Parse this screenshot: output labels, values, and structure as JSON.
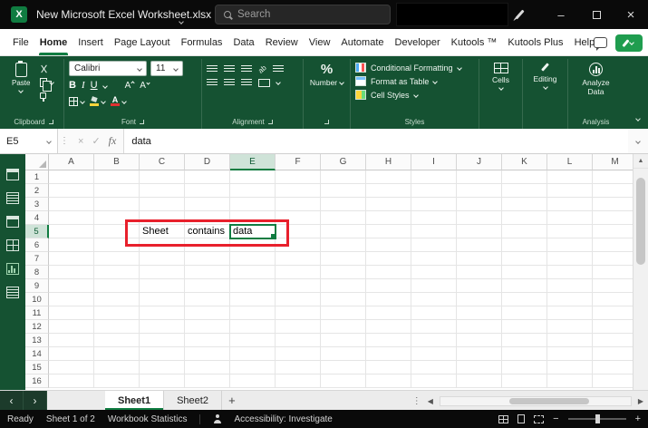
{
  "window": {
    "title": "New Microsoft Excel Worksheet.xlsx",
    "search_placeholder": "Search"
  },
  "menu": {
    "items": [
      "File",
      "Home",
      "Insert",
      "Page Layout",
      "Formulas",
      "Data",
      "Review",
      "View",
      "Automate",
      "Developer",
      "Kutools ™",
      "Kutools Plus",
      "Help"
    ],
    "active": "Home"
  },
  "ribbon": {
    "paste": "Paste",
    "clipboard_group": "Clipboard",
    "font_group": "Font",
    "font_name": "Calibri",
    "font_size": "11",
    "bold": "B",
    "italic": "I",
    "underline": "U",
    "increase_font": "A",
    "decrease_font": "A",
    "orientation": "ab",
    "alignment_group": "Alignment",
    "percent": "%",
    "number_group": "Number",
    "conditional_formatting": "Conditional Formatting",
    "format_as_table": "Format as Table",
    "cell_styles": "Cell Styles",
    "styles_group": "Styles",
    "cells": "Cells",
    "editing": "Editing",
    "analyze_data": "Analyze Data",
    "analysis_group": "Analysis"
  },
  "formula_bar": {
    "name_box": "E5",
    "fx": "fx",
    "content": "data"
  },
  "grid": {
    "columns": [
      "A",
      "B",
      "C",
      "D",
      "E",
      "F",
      "G",
      "H",
      "I",
      "J",
      "K",
      "L",
      "M"
    ],
    "row_count": 16,
    "cells": {
      "C5": "Sheet",
      "D5": "contains",
      "E5": "data"
    },
    "selection": {
      "cell": "E5",
      "column": "E",
      "row": 5
    }
  },
  "sheet_tabs": {
    "tabs": [
      "Sheet1",
      "Sheet2"
    ],
    "active": "Sheet1",
    "add_button": "+"
  },
  "status_bar": {
    "mode": "Ready",
    "sheet_info": "Sheet 1 of 2",
    "workbook_statistics": "Workbook Statistics",
    "accessibility": "Accessibility: Investigate"
  },
  "colors": {
    "accent_green": "#107C41",
    "ribbon_green": "#155232",
    "titlebar_black": "#0a0a0a",
    "annotation_red": "#E8202C",
    "share_button_green": "#1F9D4F"
  }
}
